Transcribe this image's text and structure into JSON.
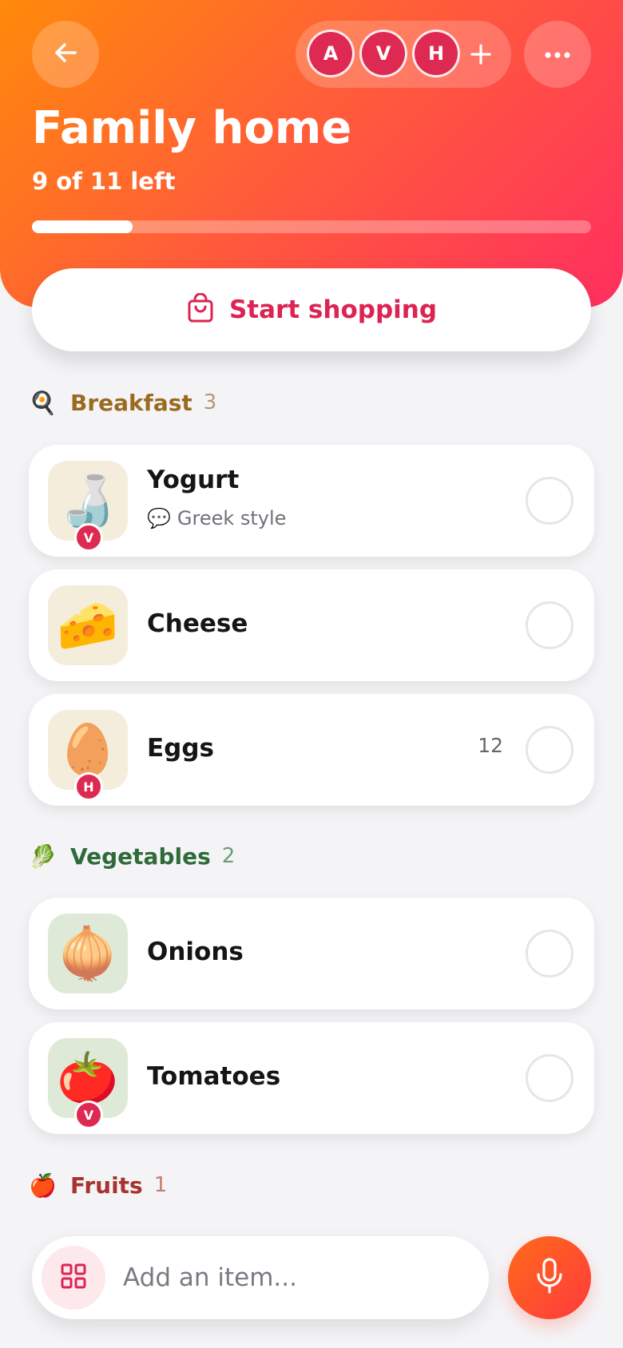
{
  "header": {
    "title": "Family home",
    "subtitle": "9 of 11 left",
    "progress_fraction": 0.18,
    "members": [
      "A",
      "V",
      "H"
    ],
    "back_icon": "arrow-left-icon",
    "add_member_icon": "plus-icon",
    "more_icon": "ellipsis-icon"
  },
  "start_button": {
    "label": "Start shopping",
    "icon": "shopping-bag-icon"
  },
  "sections": [
    {
      "emoji": "🍳",
      "name": "Breakfast",
      "count": "3",
      "color": "#9a6a1f",
      "count_color": "#b39a72",
      "items": [
        {
          "emoji": "🍶",
          "name": "Yogurt",
          "note": "Greek style",
          "note_icon": "💬",
          "badge": "V",
          "qty": ""
        },
        {
          "emoji": "🧀",
          "name": "Cheese",
          "note": "",
          "badge": "",
          "qty": ""
        },
        {
          "emoji": "🥚",
          "name": "Eggs",
          "note": "",
          "badge": "H",
          "qty": "12"
        }
      ]
    },
    {
      "emoji": "🥬",
      "name": "Vegetables",
      "count": "2",
      "color": "#2f6b3a",
      "count_color": "#6e9a76",
      "items": [
        {
          "emoji": "🧅",
          "name": "Onions",
          "note": "",
          "badge": "",
          "qty": ""
        },
        {
          "emoji": "🍅",
          "name": "Tomatoes",
          "note": "",
          "badge": "V",
          "qty": ""
        }
      ]
    },
    {
      "emoji": "🍎",
      "name": "Fruits",
      "count": "1",
      "color": "#a8322c",
      "count_color": "#c87a74",
      "items": []
    }
  ],
  "add_bar": {
    "placeholder": "Add an item...",
    "grid_icon": "grid-icon",
    "mic_icon": "microphone-icon"
  },
  "colors": {
    "accent": "#dc2453",
    "gradient_start": "#ff8a0a",
    "gradient_end": "#ff2f5f"
  }
}
